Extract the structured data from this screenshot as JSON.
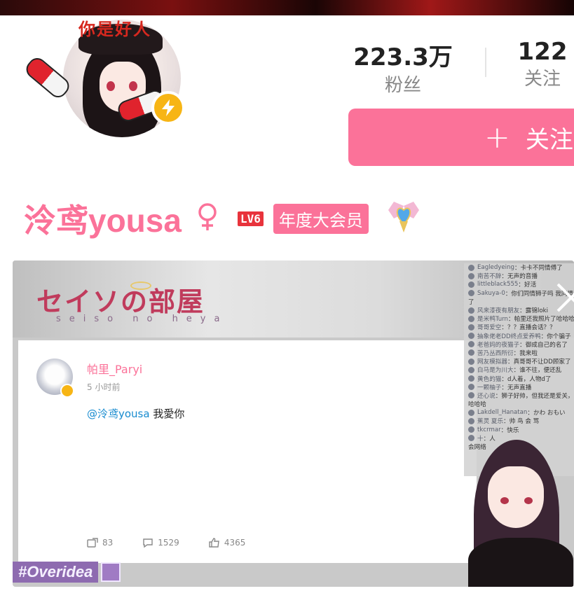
{
  "avatar": {
    "caption": "你是好人",
    "verified_icon": "lightning-icon"
  },
  "stats": {
    "fans": {
      "value": "223.3万",
      "label": "粉丝"
    },
    "following": {
      "value": "122",
      "label": "关注"
    }
  },
  "follow_button": {
    "plus": "+",
    "label": "关注"
  },
  "profile": {
    "username": "泠鸢yousa",
    "gender_icon": "female-icon",
    "level": "LV6",
    "vip": "年度大会员",
    "medal_icon": "winged-heart-medal-icon"
  },
  "video": {
    "room_title": "セイソの部屋",
    "room_subtitle": "seiso no heya",
    "post": {
      "author": "帕里_Paryi",
      "time": "5 小时前",
      "mention": "@泠鸢yousa",
      "text": " 我愛你",
      "reposts": "83",
      "comments": "1529",
      "likes": "4365"
    },
    "danmaku": [
      {
        "user": "Eagledyeing",
        "text": "：卡卡不同情傅了"
      },
      {
        "user": "南苦不辞",
        "text": "：无声的音播"
      },
      {
        "user": "littleblack555",
        "text": "：好活"
      },
      {
        "user": "Sakuya-0",
        "text": "：你们同情狮子吗 我同情"
      },
      {
        "user": "",
        "text": "了"
      },
      {
        "user": "风来漆夜有朋友",
        "text": "：露锦loki"
      },
      {
        "user": "是米鸭Turn",
        "text": "：帕里还我照片了哈哈哈"
      },
      {
        "user": "哥哥爱空",
        "text": "：？？直播会话？？"
      },
      {
        "user": "抽象佬老DD终点爱养鸭",
        "text": "：你个骗子"
      },
      {
        "user": "老爸妈的夜猫子",
        "text": "：御成自己的名了"
      },
      {
        "user": "苦乃丛西所衍",
        "text": "：我来啦"
      },
      {
        "user": "网友模拟器",
        "text": "：真哥哥不让DD顾家了"
      },
      {
        "user": "白马是为川大",
        "text": "：谁不往，便还乱"
      },
      {
        "user": "黄色的猫",
        "text": "：d人着，人物d了"
      },
      {
        "user": "一颗柚子",
        "text": "：无声直播"
      },
      {
        "user": "还心说",
        "text": "：狮子好帅，但我还是爱关，"
      },
      {
        "user": "",
        "text": "哈哈哈"
      },
      {
        "user": "Lakdell_Hanatan",
        "text": "：かわ おもい"
      },
      {
        "user": "蕉灵 夏乐",
        "text": "：帅 鸟 会 骂"
      },
      {
        "user": "tkcrmar",
        "text": "：快乐"
      },
      {
        "user": "十",
        "text": "：人"
      },
      {
        "user": "",
        "text": "会网络"
      }
    ],
    "close_icon": "close-icon",
    "tag": "#Overidea"
  }
}
